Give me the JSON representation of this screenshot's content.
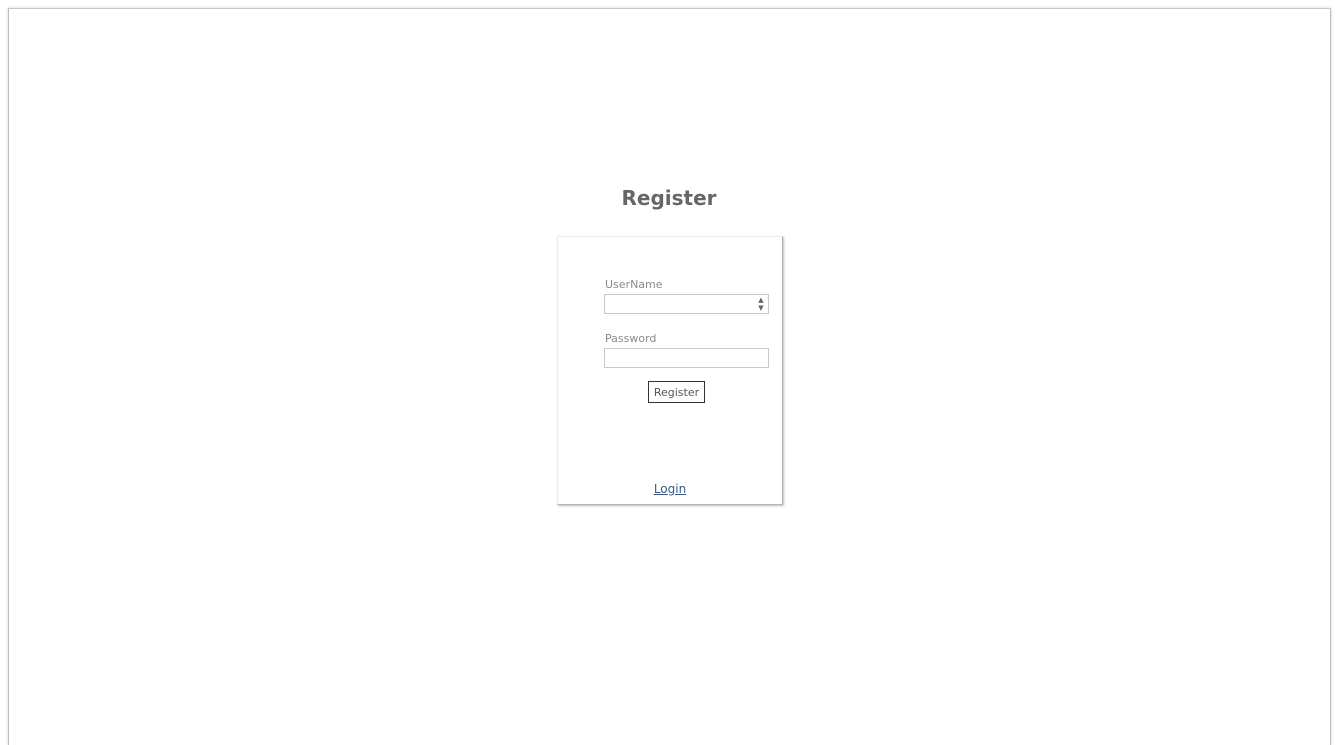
{
  "page": {
    "title": "Register"
  },
  "form": {
    "username_label": "UserName",
    "username_value": "",
    "password_label": "Password",
    "password_value": "",
    "register_button_label": "Register",
    "login_link_label": "Login"
  },
  "icons": {
    "spinner_up": "spin-up-icon",
    "spinner_down": "spin-down-icon"
  },
  "colors": {
    "title_text": "#666666",
    "label_text": "#8a8a8a",
    "link": "#3b5a88",
    "button_border": "#333333"
  }
}
